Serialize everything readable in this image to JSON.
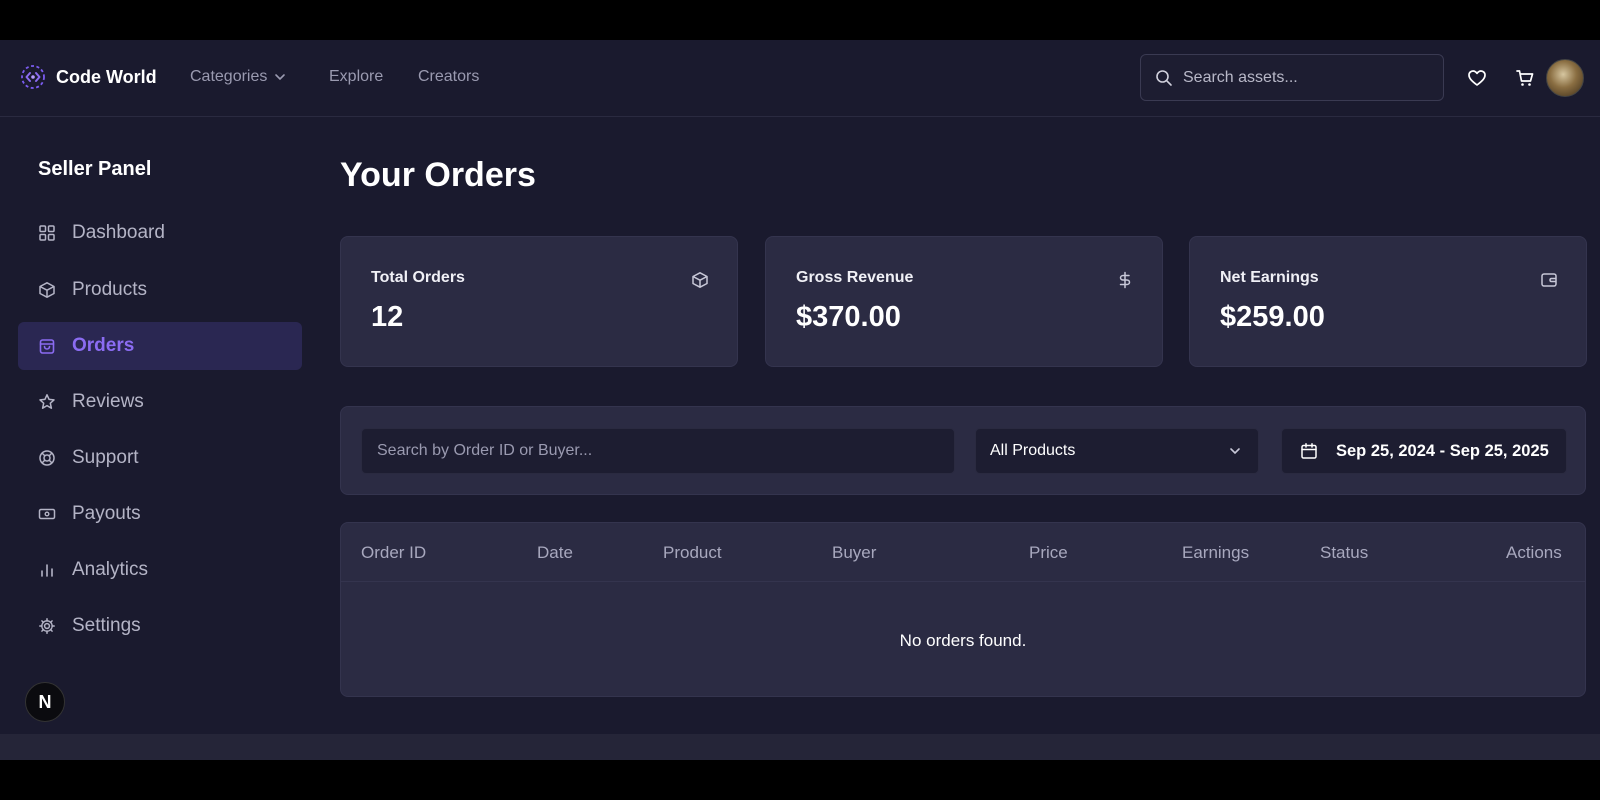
{
  "app": {
    "brand": "Code World",
    "nav": [
      {
        "label": "Categories",
        "has_dropdown": true
      },
      {
        "label": "Explore"
      },
      {
        "label": "Creators"
      }
    ],
    "search_placeholder": "Search assets...",
    "icons": [
      "heart-icon",
      "cart-icon"
    ]
  },
  "sidebar": {
    "title": "Seller Panel",
    "items": [
      {
        "label": "Dashboard",
        "icon": "grid-icon"
      },
      {
        "label": "Products",
        "icon": "box-icon"
      },
      {
        "label": "Orders",
        "icon": "bag-icon",
        "active": true
      },
      {
        "label": "Reviews",
        "icon": "star-icon"
      },
      {
        "label": "Support",
        "icon": "lifebuoy-icon"
      },
      {
        "label": "Payouts",
        "icon": "cash-icon"
      },
      {
        "label": "Analytics",
        "icon": "bar-chart-icon"
      },
      {
        "label": "Settings",
        "icon": "gear-icon"
      }
    ],
    "badge": "N"
  },
  "main": {
    "title": "Your Orders",
    "stats": [
      {
        "label": "Total Orders",
        "value": "12",
        "icon": "box-icon"
      },
      {
        "label": "Gross Revenue",
        "value": "$370.00",
        "icon": "dollar-icon"
      },
      {
        "label": "Net Earnings",
        "value": "$259.00",
        "icon": "wallet-icon"
      }
    ],
    "filters": {
      "search_placeholder": "Search by Order ID or Buyer...",
      "product_select": "All Products",
      "date_range": "Sep 25, 2024 - Sep 25, 2025"
    },
    "table": {
      "columns": [
        "Order ID",
        "Date",
        "Product",
        "Buyer",
        "Price",
        "Earnings",
        "Status",
        "Actions"
      ],
      "empty_message": "No orders found."
    }
  },
  "colors": {
    "background": "#1a1a2e",
    "card": "#2b2b43",
    "accent": "#8b6cf2",
    "active_bg": "#2a2752"
  }
}
